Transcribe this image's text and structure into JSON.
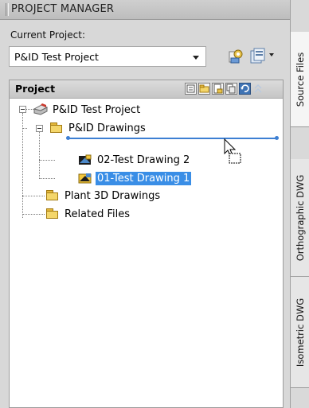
{
  "window": {
    "title": "PROJECT MANAGER"
  },
  "current_project": {
    "label": "Current Project:",
    "value": "P&ID Test Project"
  },
  "toolbar": {
    "buttons": [
      {
        "icon": "project-settings-icon"
      },
      {
        "icon": "project-menu-icon"
      }
    ]
  },
  "panel": {
    "title": "Project",
    "header_icons": [
      "properties-icon",
      "new-folder-icon",
      "new-drawing-icon",
      "copy-icon",
      "refresh-icon",
      "collapse-icon"
    ]
  },
  "tree": {
    "root": "P&ID Test Project",
    "pid_folder": "P&ID Drawings",
    "drawing_1": "02-Test Drawing 2",
    "drawing_2": "01-Test Drawing 1",
    "plant3d_folder": "Plant 3D Drawings",
    "related_folder": "Related Files"
  },
  "side_tabs": [
    "Source Files",
    "Orthographic DWG",
    "Isometric DWG"
  ],
  "colors": {
    "selection": "#3a8ee6",
    "drag_indicator": "#3d7fd3"
  }
}
